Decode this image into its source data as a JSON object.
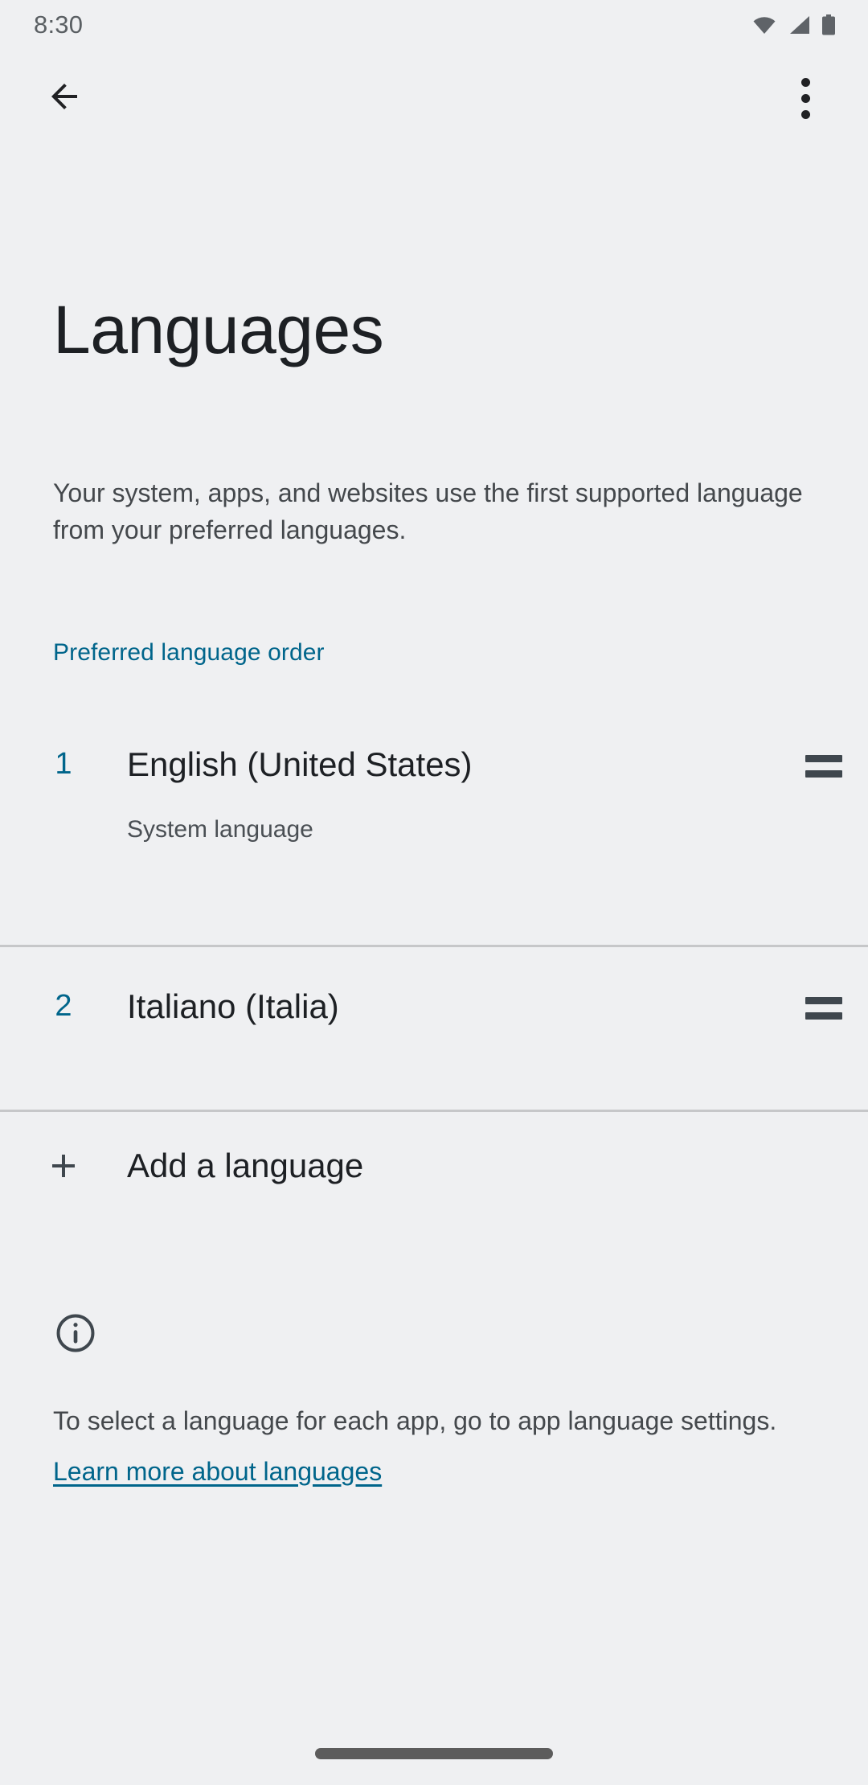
{
  "status_bar": {
    "time": "8:30",
    "icons": [
      "wifi-icon",
      "cellular-signal-icon",
      "battery-icon"
    ]
  },
  "app_bar": {
    "back_icon": "back-arrow-icon",
    "overflow_icon": "more-options-icon"
  },
  "page": {
    "title": "Languages",
    "description": "Your system, apps, and websites use the first supported language from your preferred languages."
  },
  "section": {
    "header": "Preferred language order"
  },
  "languages": [
    {
      "index": "1",
      "name": "English (United States)",
      "subtitle": "System language",
      "handle_icon": "drag-handle-icon"
    },
    {
      "index": "2",
      "name": "Italiano (Italia)",
      "subtitle": "",
      "handle_icon": "drag-handle-icon"
    }
  ],
  "add_language": {
    "label": "Add a language",
    "icon": "plus-icon"
  },
  "footer": {
    "icon": "info-icon",
    "text": "To select a language for each app, go to app language settings.",
    "link": "Learn more about languages"
  },
  "nav": {
    "pill": "home-gesture-pill"
  },
  "colors": {
    "background": "#eff0f2",
    "accent": "#00658b",
    "primary_text": "#1d2024",
    "secondary_text": "#44484c",
    "divider": "#c6c7c9"
  }
}
